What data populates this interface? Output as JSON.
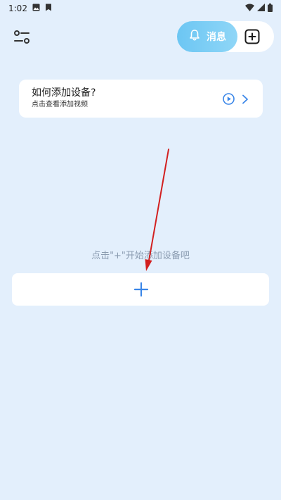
{
  "status_bar": {
    "time": "1:02",
    "icons": [
      "image-icon",
      "sim-card-icon",
      "wifi-icon",
      "signal-icon",
      "battery-icon"
    ]
  },
  "toolbar": {
    "filter_icon": "filter-sliders-icon",
    "messages_label": "消息",
    "messages_icon": "bell-icon",
    "add_icon": "plus-square-icon"
  },
  "howto_card": {
    "title": "如何添加设备?",
    "subtitle": "点击查看添加视频",
    "play_icon": "play-circle-icon",
    "chevron_icon": "chevron-right-icon"
  },
  "empty_state": {
    "hint": "点击\"+\"开始添加设备吧"
  },
  "add_device": {
    "icon": "plus-icon"
  },
  "colors": {
    "background": "#e3effc",
    "accent": "#3a86e8",
    "messages_gradient_start": "#6cc6f3",
    "messages_gradient_end": "#8fd6f7",
    "annotation_arrow": "#d21f1f"
  }
}
